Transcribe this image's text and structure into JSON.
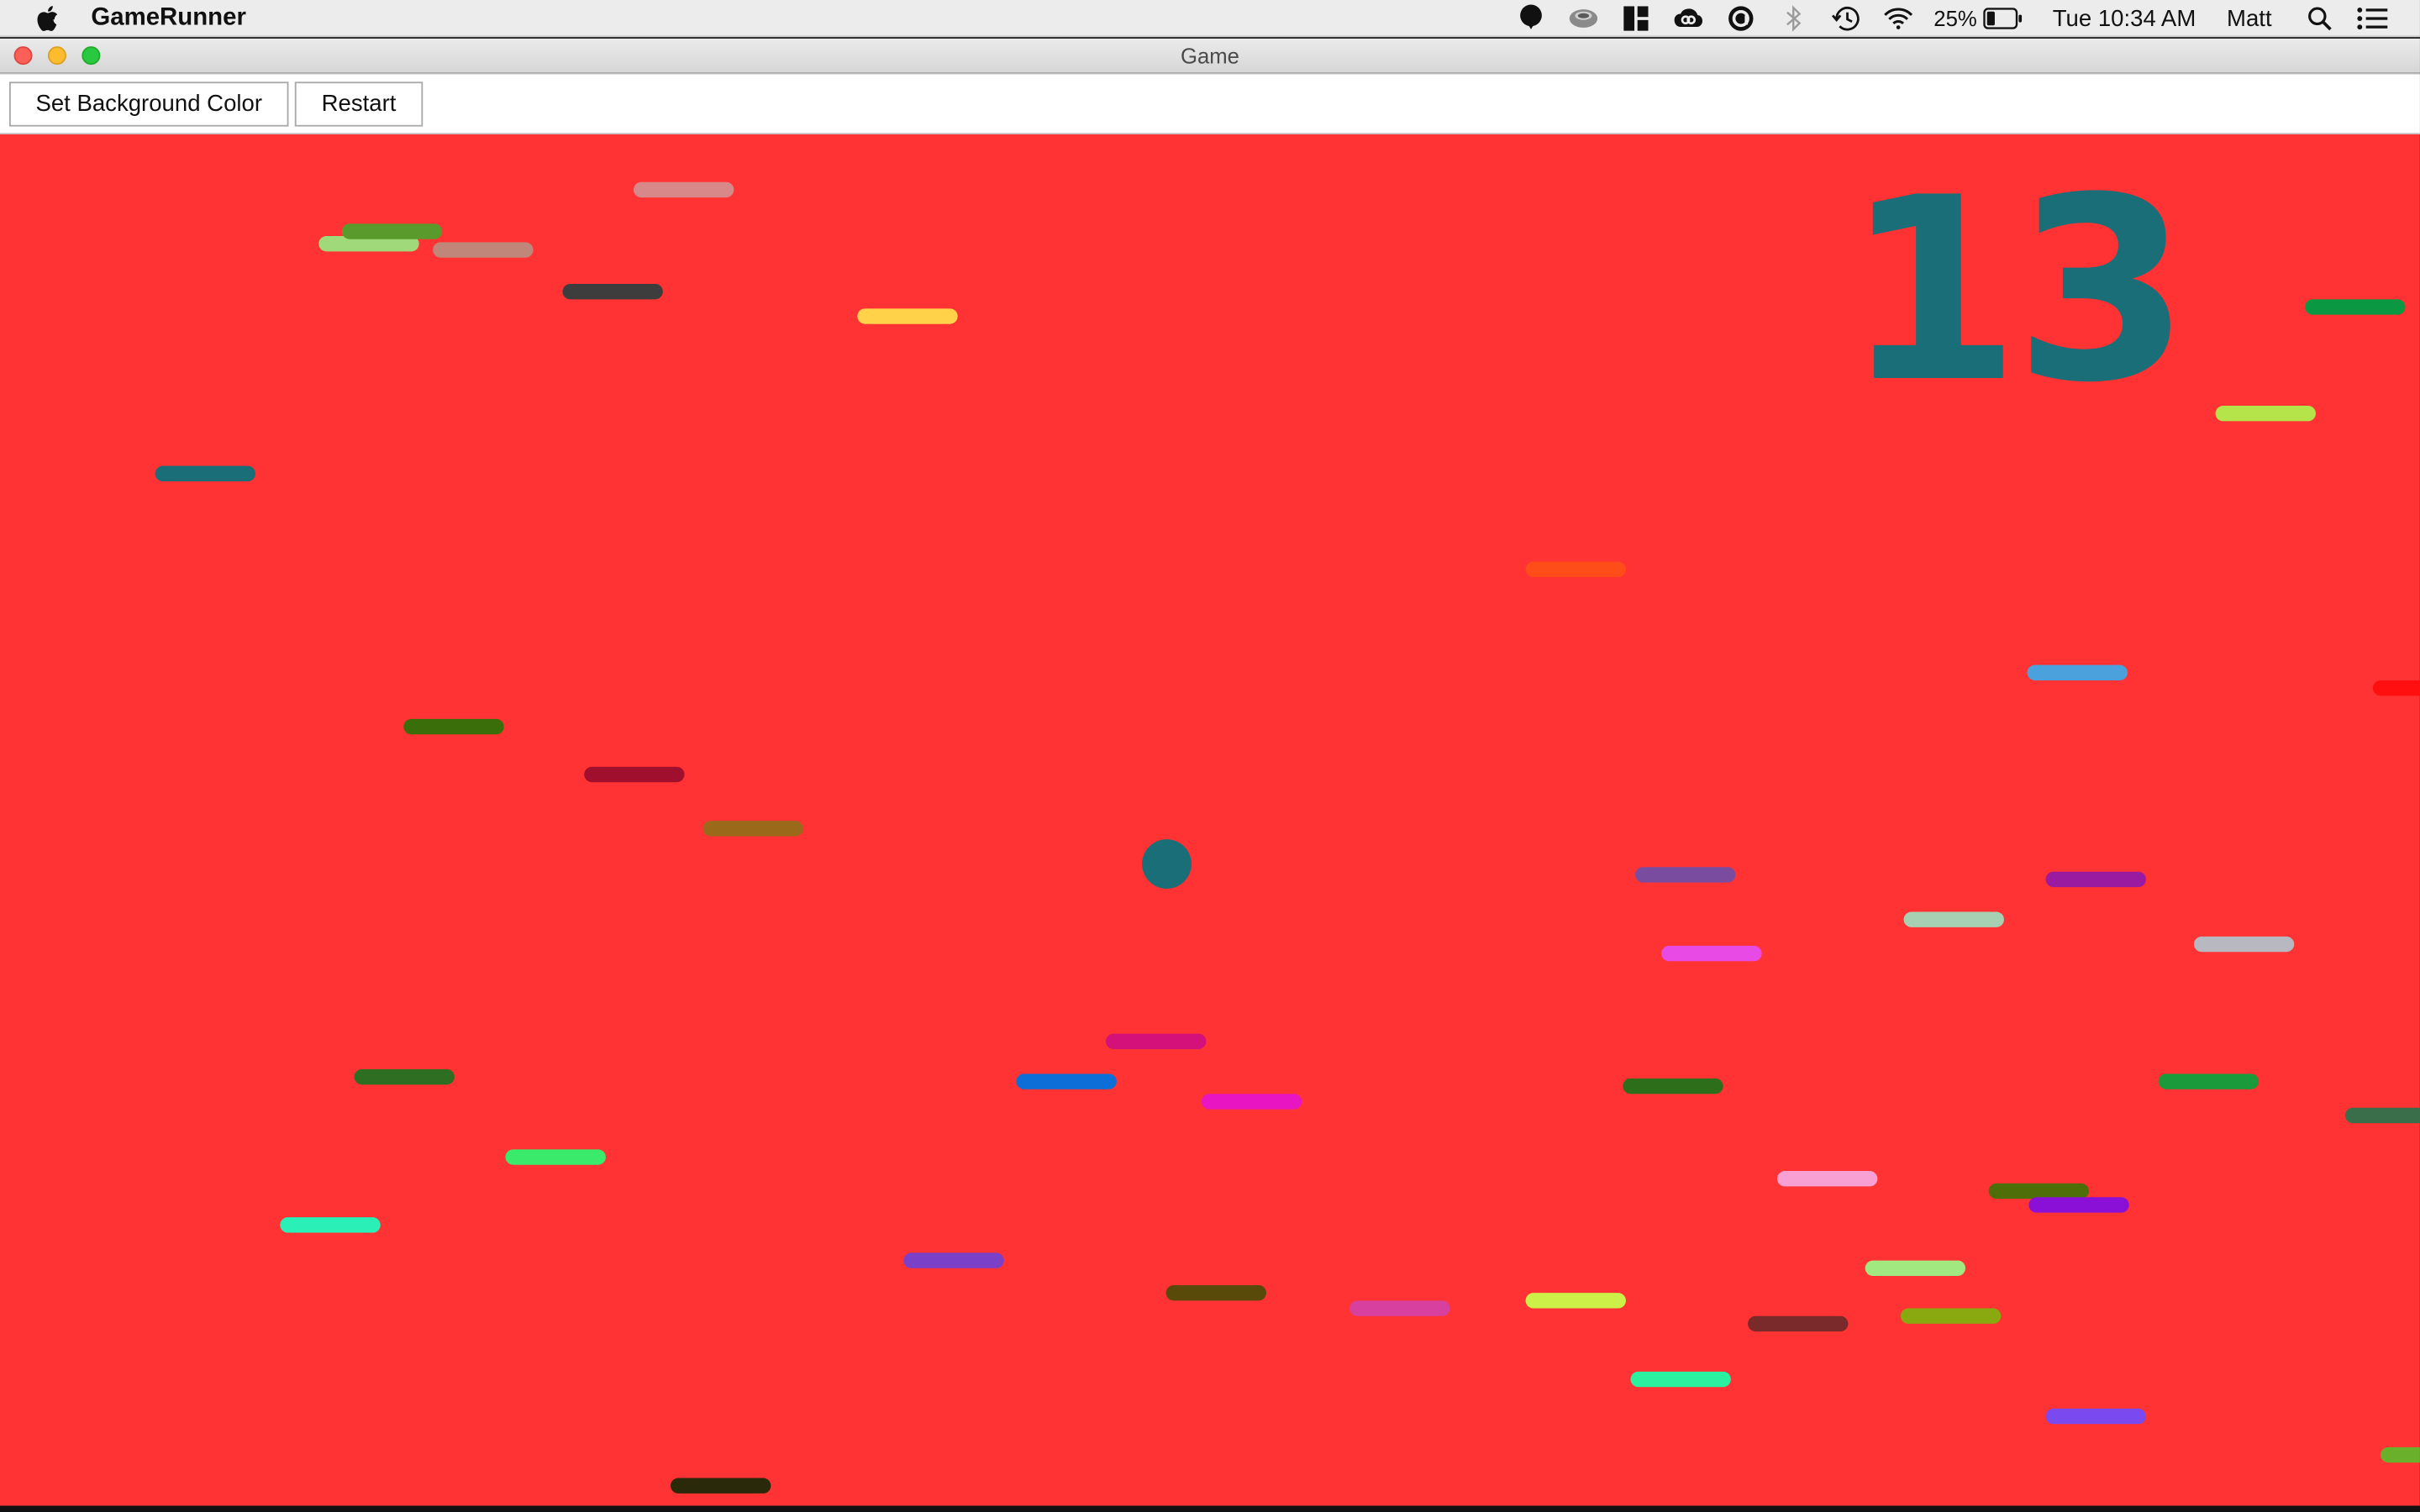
{
  "menubar": {
    "app_name": "GameRunner",
    "battery_percent": "25%",
    "clock": "Tue 10:34 AM",
    "user": "Matt",
    "status_icons": [
      "balloon-icon",
      "coffee-cup-icon",
      "dashboard-icon",
      "creative-cloud-icon",
      "circle-a-icon",
      "bluetooth-icon",
      "time-machine-icon",
      "wifi-icon",
      "battery-icon",
      "spotlight-search-icon",
      "notification-center-icon"
    ]
  },
  "window": {
    "title": "Game"
  },
  "toolbar": {
    "background_color_label": "Set Background Color",
    "restart_label": "Restart"
  },
  "game": {
    "background_color": "#ff3333",
    "score": "13",
    "score_color": "#196e78",
    "player_color": "#196e78",
    "obstacle_count": 50,
    "obstacle_colors": [
      "#a0d97a",
      "#5a9a2c",
      "#c0867a",
      "#d88888",
      "#3d3d3d",
      "#ffd24a",
      "#196e78",
      "#0a9942",
      "#b5e34a",
      "#ff4d1a",
      "#4aa1db",
      "#ff0f0f",
      "#3a6e0a",
      "#a0102e",
      "#9a6a1a",
      "#7a4ca0",
      "#9a1aa0",
      "#a7cfb2",
      "#b8b8c0",
      "#e84ae6",
      "#d4107a",
      "#0e6ed8",
      "#e815c2",
      "#2d6e22",
      "#2c6e1a",
      "#1a9a3a",
      "#3a6e4a",
      "#3aea6a",
      "#2af0b8",
      "#f8a0d4",
      "#4e6e0a",
      "#8a10d8",
      "#7a40c8",
      "#5a4a0a",
      "#d840a0",
      "#cdf048",
      "#7a2a2a",
      "#a2e880",
      "#8aa810",
      "#2af0a0",
      "#7a4af0",
      "#2a2a0a",
      "#6ab02a"
    ]
  }
}
